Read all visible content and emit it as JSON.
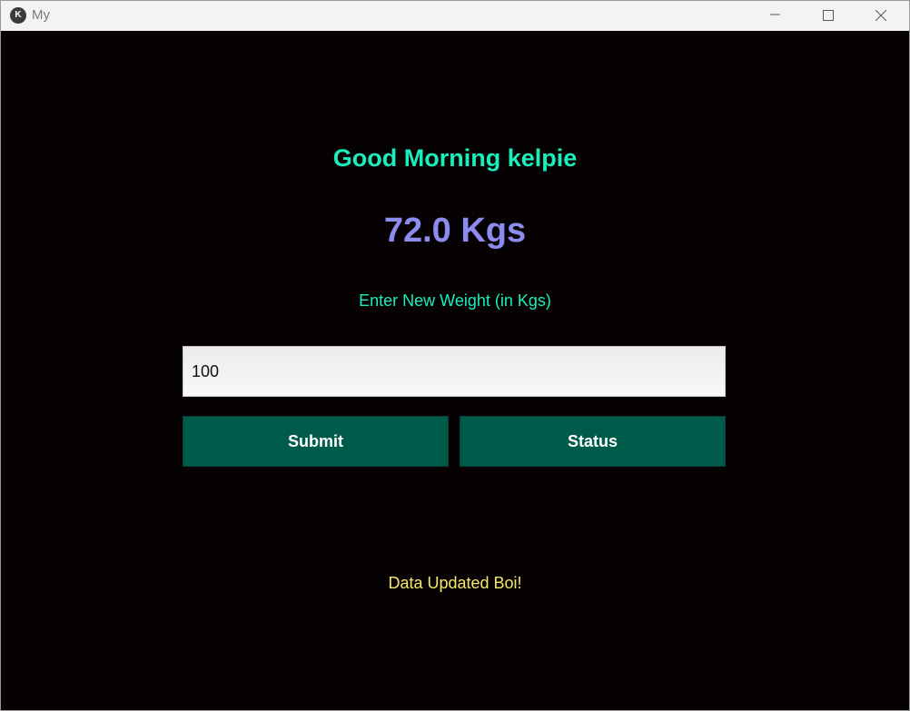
{
  "window": {
    "title": "My",
    "app_icon": "kivy-logo-icon",
    "controls": [
      "minimize-icon",
      "maximize-icon",
      "close-icon"
    ]
  },
  "main": {
    "greeting": "Good Morning kelpie",
    "current_weight": "72.0 Kgs",
    "prompt": "Enter New Weight (in Kgs)",
    "weight_input_value": "100",
    "submit_label": "Submit",
    "status_label": "Status",
    "status_message": "Data Updated Boi!"
  },
  "colors": {
    "background": "#060203",
    "greeting": "#19efbd",
    "weight": "#8c8cf0",
    "button": "#005c4a",
    "message": "#f4e96a"
  }
}
